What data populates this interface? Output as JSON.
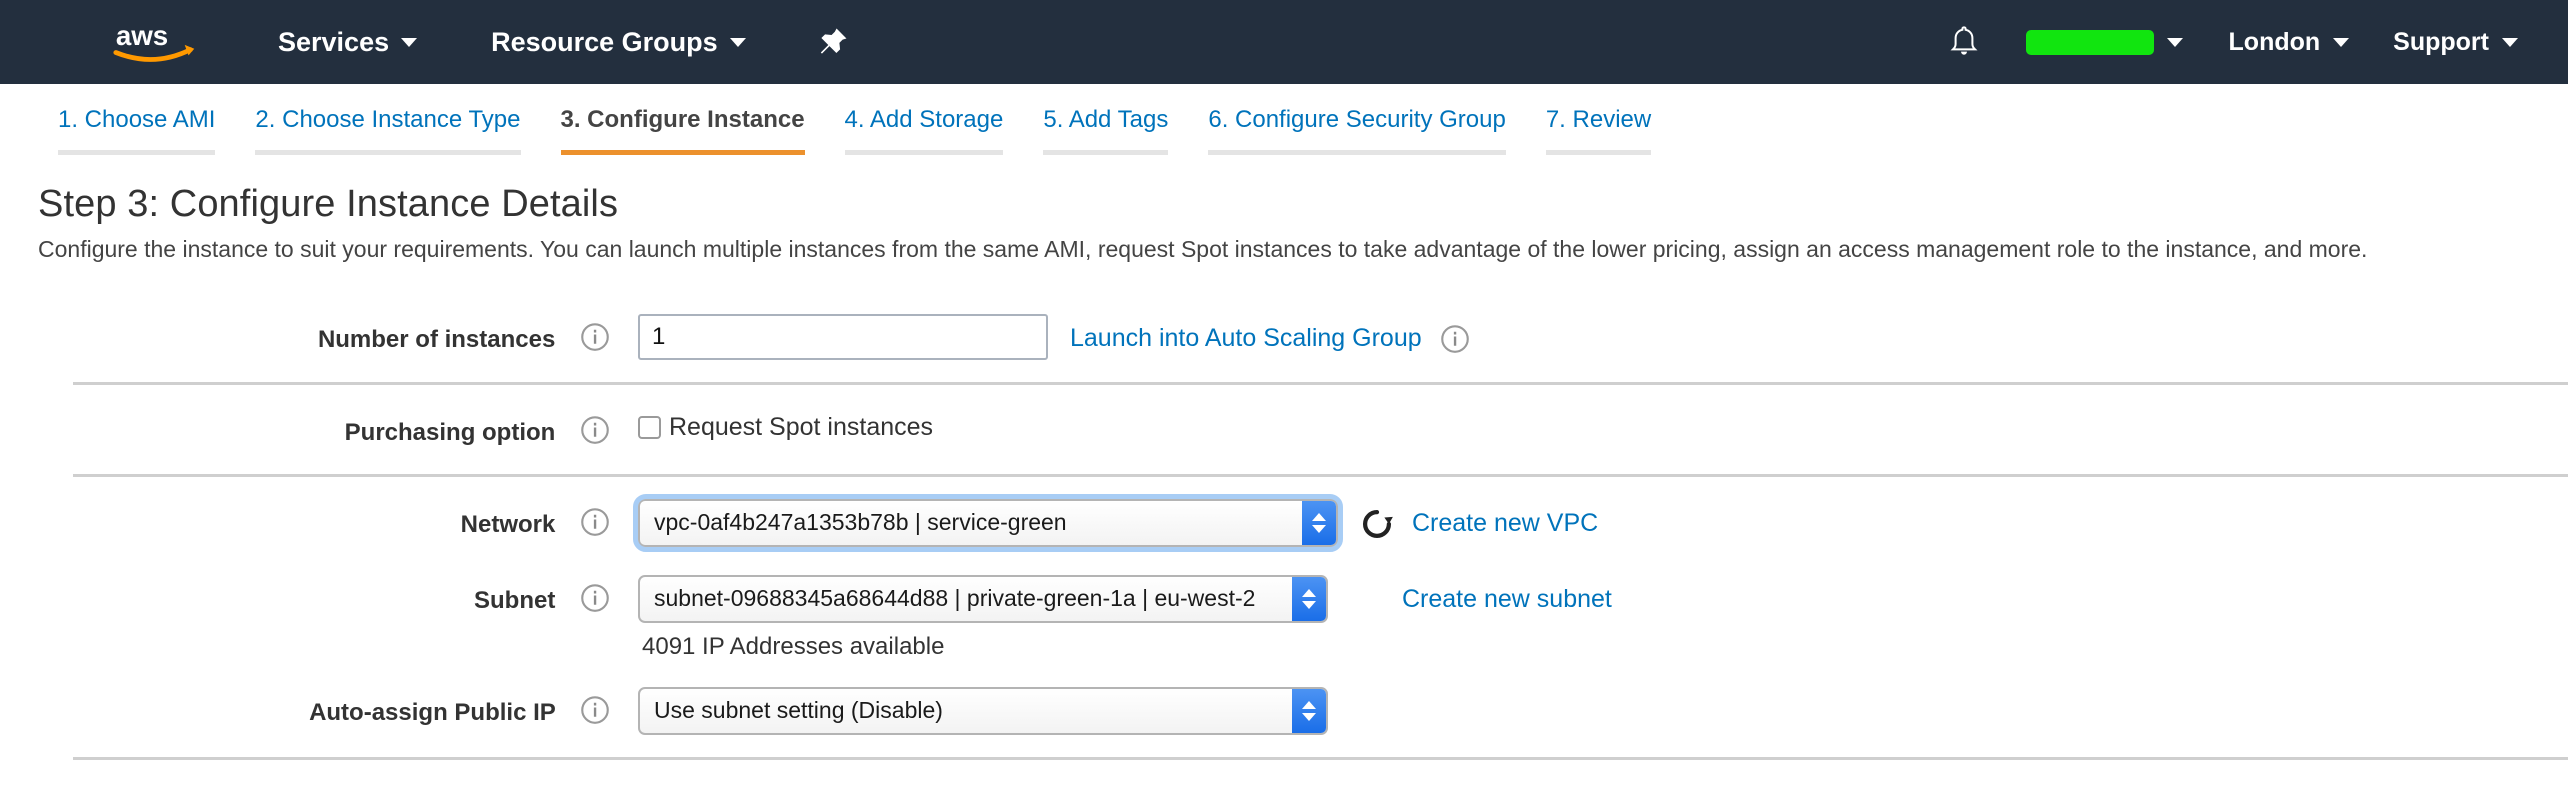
{
  "navbar": {
    "logo_alt": "aws",
    "menus": [
      {
        "label": "Services",
        "icon": "chevron-down-icon"
      },
      {
        "label": "Resource Groups",
        "icon": "chevron-down-icon"
      }
    ],
    "pin_icon": "pushpin-icon",
    "bell_icon": "bell-notification-icon",
    "account_label": "",
    "region_label": "London",
    "support_label": "Support",
    "background_color": "#232f3e",
    "account_redaction_color": "#11e50f"
  },
  "wizard_tabs": [
    {
      "label": "1. Choose AMI",
      "active": false
    },
    {
      "label": "2. Choose Instance Type",
      "active": false
    },
    {
      "label": "3. Configure Instance",
      "active": true
    },
    {
      "label": "4. Add Storage",
      "active": false
    },
    {
      "label": "5. Add Tags",
      "active": false
    },
    {
      "label": "6. Configure Security Group",
      "active": false
    },
    {
      "label": "7. Review",
      "active": false
    }
  ],
  "page": {
    "title": "Step 3: Configure Instance Details",
    "description": "Configure the instance to suit your requirements. You can launch multiple instances from the same AMI, request Spot instances to take advantage of the lower pricing, assign an access management role to the instance, and more."
  },
  "form": {
    "number_of_instances": {
      "label": "Number of instances",
      "info_icon": "info-icon",
      "value": "1",
      "link_label": "Launch into Auto Scaling Group",
      "link_info_icon": "info-icon"
    },
    "purchasing_option": {
      "label": "Purchasing option",
      "info_icon": "info-icon",
      "checkbox_label": "Request Spot instances",
      "checked": false
    },
    "network": {
      "label": "Network",
      "info_icon": "info-icon",
      "value": "vpc-0af4b247a1353b78b | service-green",
      "focused": true,
      "refresh_icon": "refresh-icon",
      "link_label": "Create new VPC"
    },
    "subnet": {
      "label": "Subnet",
      "info_icon": "info-icon",
      "value": "subnet-09688345a68644d88 | private-green-1a | eu-west-2",
      "helper_text": "4091 IP Addresses available",
      "link_label": "Create new subnet"
    },
    "auto_assign_public_ip": {
      "label": "Auto-assign Public IP",
      "info_icon": "info-icon",
      "value": "Use subnet setting (Disable)"
    }
  },
  "colors": {
    "link_blue": "#0073bb",
    "active_tab_orange": "#ec912d",
    "nav_background": "#232f3e"
  }
}
